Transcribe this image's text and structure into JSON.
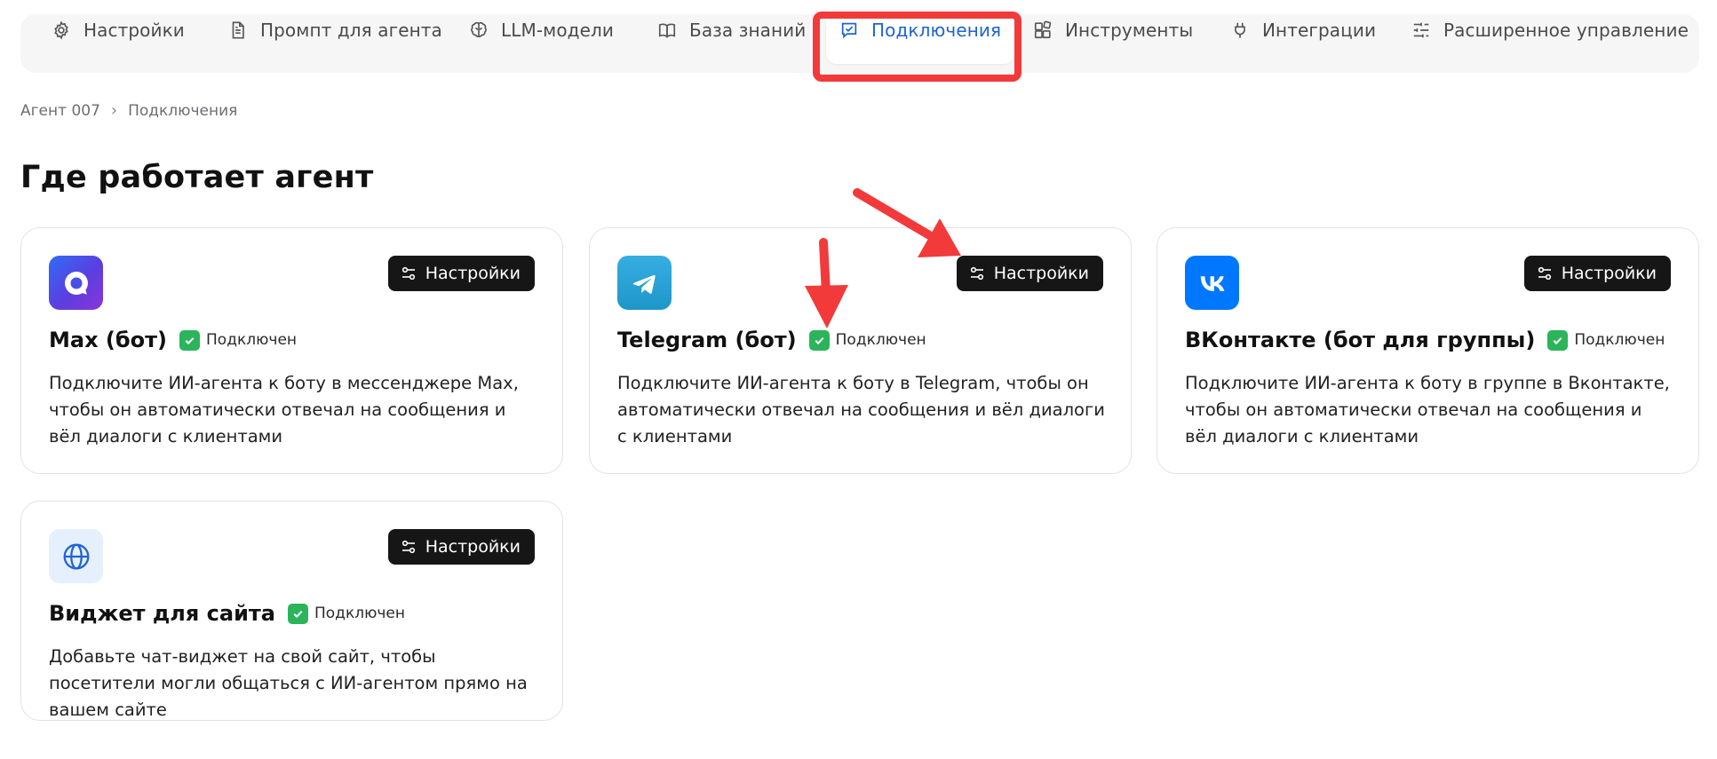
{
  "nav": {
    "items": [
      {
        "label": "Настройки",
        "icon": "gear-icon"
      },
      {
        "label": "Промпт для агента",
        "icon": "document-icon"
      },
      {
        "label": "LLM-модели",
        "icon": "brain-icon"
      },
      {
        "label": "База знаний",
        "icon": "book-icon"
      },
      {
        "label": "Подключения",
        "icon": "connection-check-icon"
      },
      {
        "label": "Инструменты",
        "icon": "blocks-icon"
      },
      {
        "label": "Интеграции",
        "icon": "plug-icon"
      },
      {
        "label": "Расширенное управление",
        "icon": "sliders-icon"
      }
    ],
    "active_index": 4,
    "active_color": "#1f63d6"
  },
  "breadcrumb": {
    "items": [
      "Агент 007",
      "Подключения"
    ]
  },
  "page": {
    "title": "Где работает агент"
  },
  "cards": [
    {
      "title": "Max (бот)",
      "status": "Подключен",
      "button": "Настройки",
      "description": "Подключите ИИ-агента к боту в мессенджере Max, чтобы он автоматически отвечал на сообщения и вёл диалоги с клиентами",
      "icon": "max-logo-icon"
    },
    {
      "title": "Telegram (бот)",
      "status": "Подключен",
      "button": "Настройки",
      "description": "Подключите ИИ-агента к боту в Telegram, чтобы он автоматически отвечал на сообщения и вёл диалоги с клиентами",
      "icon": "telegram-logo-icon"
    },
    {
      "title": "ВКонтакте (бот для группы)",
      "status": "Подключен",
      "button": "Настройки",
      "description": "Подключите ИИ-агента к боту в группе в Вконтакте, чтобы он автоматически отвечал на сообщения и вёл диалоги с клиентами",
      "icon": "vk-logo-icon"
    },
    {
      "title": "Виджет для сайта",
      "status": "Подключен",
      "button": "Настройки",
      "description": "Добавьте чат-виджет на свой сайт, чтобы посетители могли общаться с ИИ-агентом прямо на вашем сайте",
      "icon": "globe-icon"
    }
  ],
  "colors": {
    "status_green": "#2bb45a",
    "annotation_red": "#f23a3a",
    "button_dark": "#161616"
  }
}
